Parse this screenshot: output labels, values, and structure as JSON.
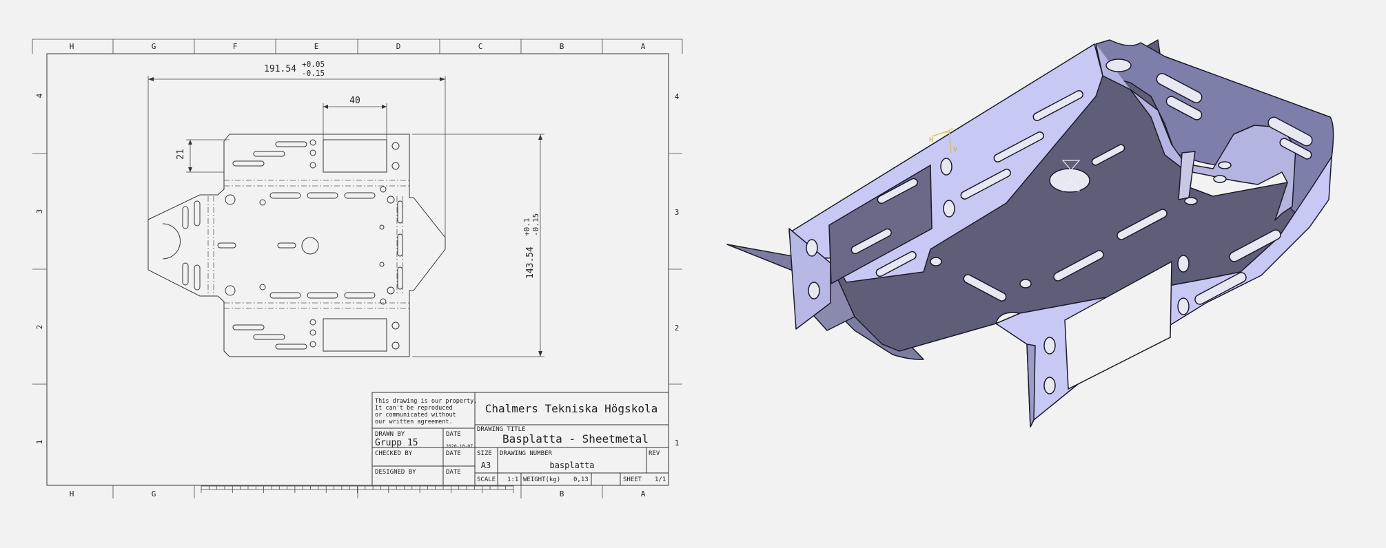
{
  "drawing": {
    "border_columns": [
      "H",
      "G",
      "F",
      "E",
      "D",
      "C",
      "B",
      "A"
    ],
    "border_rows": [
      "4",
      "3",
      "2",
      "1"
    ],
    "dimensions": {
      "overall_width": "191.54",
      "overall_width_tol_upper": "+0.05",
      "overall_width_tol_lower": "-0.15",
      "slot_width": "40",
      "offset_height": "21",
      "overall_height": "143.54",
      "overall_height_tol_upper": "+0.1",
      "overall_height_tol_lower": "-0.15"
    },
    "title_block": {
      "property_notice": [
        "This drawing is our property.",
        "It can't be reproduced",
        "or communicated without",
        "our written agreement."
      ],
      "company": "Chalmers Tekniska Högskola",
      "drawn_by_label": "DRAWN BY",
      "drawn_by": "Grupp 15",
      "date_label": "DATE",
      "drawn_date": "2020-10-07",
      "checked_by_label": "CHECKED BY",
      "designed_by_label": "DESIGNED BY",
      "drawing_title_label": "DRAWING TITLE",
      "drawing_title": "Basplatta - Sheetmetal",
      "size_label": "SIZE",
      "size": "A3",
      "drawing_number_label": "DRAWING NUMBER",
      "drawing_number": "basplatta",
      "rev_label": "REV",
      "scale_label": "SCALE",
      "scale": "1:1",
      "weight_label": "WEIGHT(kg)",
      "weight": "0,13",
      "sheet_label": "SHEET",
      "sheet": "1/1"
    }
  },
  "model": {
    "axis_labels": [
      "H",
      "V"
    ],
    "colors": {
      "light_face": "#c8c8f5",
      "dark_face": "#5e5e78",
      "mid_face": "#7c7ca0",
      "edge": "#1a1a2a"
    }
  }
}
